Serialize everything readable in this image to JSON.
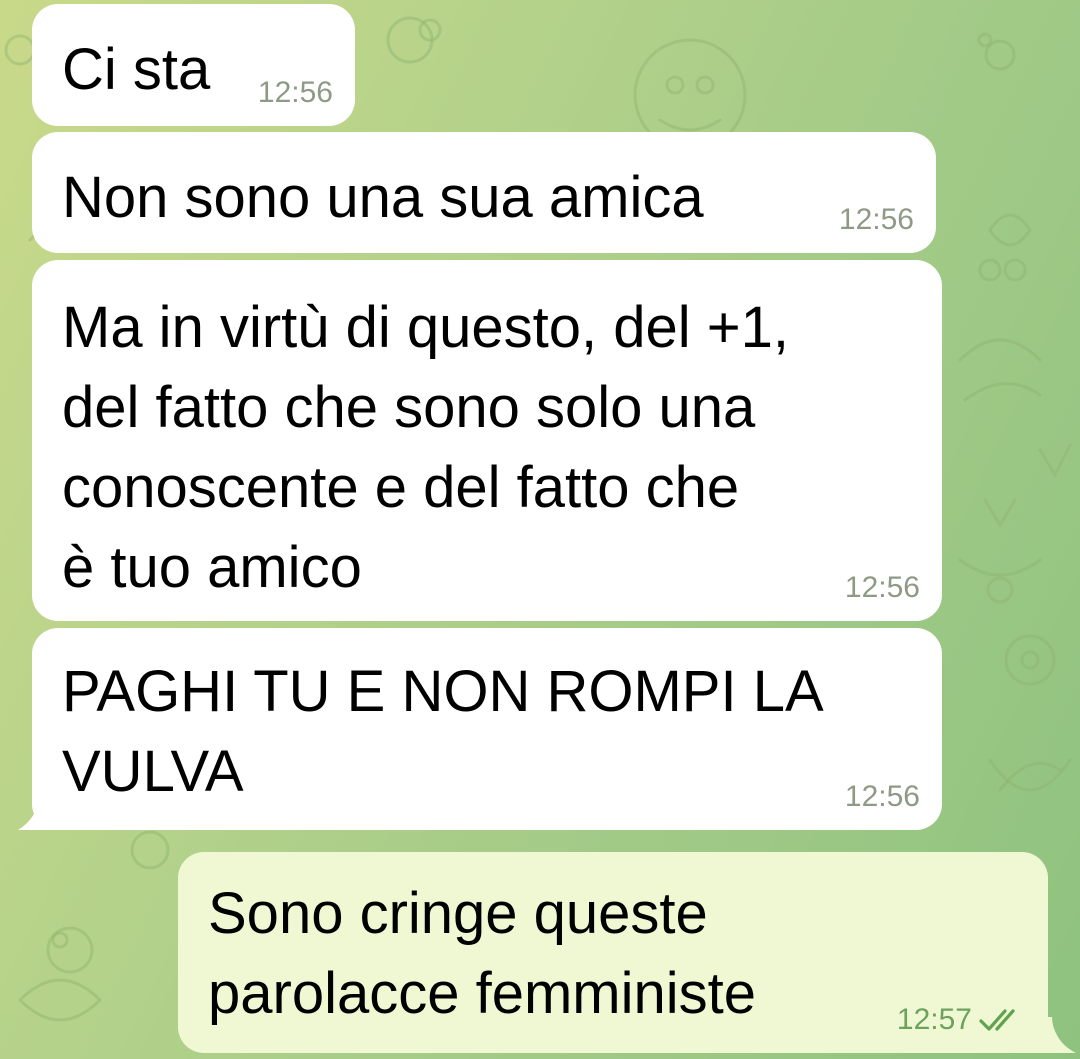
{
  "chat": {
    "messages": [
      {
        "direction": "incoming",
        "text": "Ci sta",
        "time": "12:56"
      },
      {
        "direction": "incoming",
        "text": "Non sono una sua amica",
        "time": "12:56"
      },
      {
        "direction": "incoming",
        "text": "Ma in virtù di questo, del +1,\ndel fatto che sono solo una\nconoscente e del fatto che\nè tuo amico",
        "time": "12:56"
      },
      {
        "direction": "incoming",
        "text": "PAGHI TU E NON ROMPI LA\nVULVA",
        "time": "12:56"
      },
      {
        "direction": "outgoing",
        "text": "Sono cringe queste\nparolacce femministe",
        "time": "12:57",
        "status_icon": "double-check-icon"
      }
    ]
  },
  "colors": {
    "incoming_bubble": "#ffffff",
    "outgoing_bubble": "#eff8d2",
    "timestamp": "#8e9a86",
    "outgoing_timestamp": "#6da15e",
    "read_ticks": "#5fa24f"
  }
}
